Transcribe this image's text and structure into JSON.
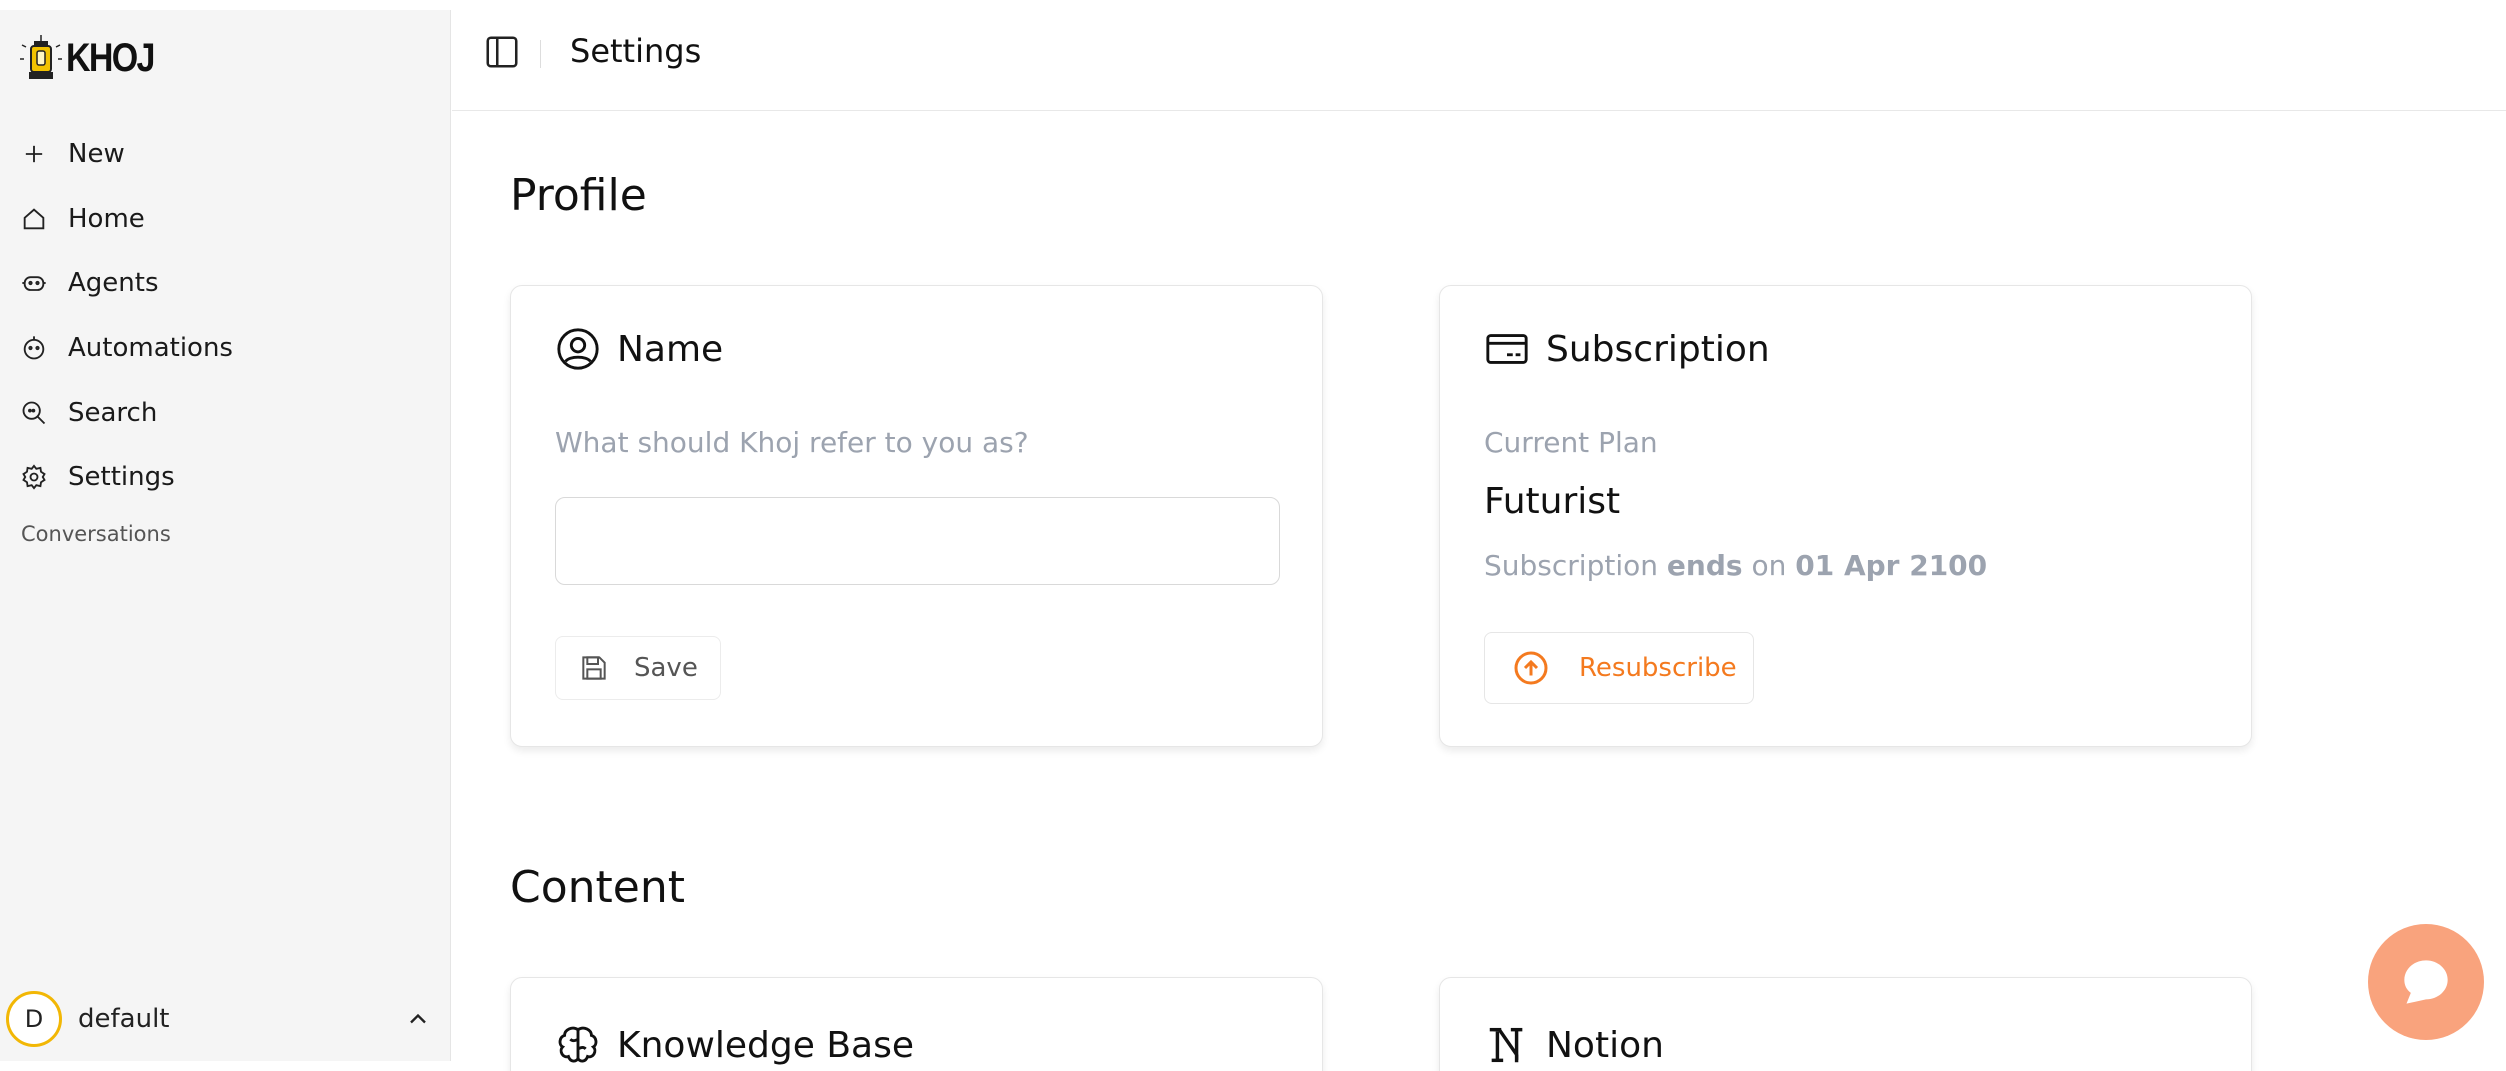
{
  "app": {
    "logo_text": "KHOJ"
  },
  "sidebar": {
    "items": [
      {
        "label": "New",
        "icon": "plus-icon"
      },
      {
        "label": "Home",
        "icon": "home-icon"
      },
      {
        "label": "Agents",
        "icon": "robot-icon"
      },
      {
        "label": "Automations",
        "icon": "automation-icon"
      },
      {
        "label": "Search",
        "icon": "search-icon"
      },
      {
        "label": "Settings",
        "icon": "gear-icon"
      }
    ],
    "section_label": "Conversations",
    "user": {
      "initial": "D",
      "name": "default"
    }
  },
  "header": {
    "title": "Settings"
  },
  "profile": {
    "section_title": "Profile",
    "name_card": {
      "title": "Name",
      "hint": "What should Khoj refer to you as?",
      "input_value": "",
      "save_label": "Save"
    },
    "subscription_card": {
      "title": "Subscription",
      "plan_label": "Current Plan",
      "plan_name": "Futurist",
      "line_prefix": "Subscription",
      "line_ends": "ends",
      "line_on": "on",
      "line_date": "01 Apr 2100",
      "resubscribe_label": "Resubscribe"
    }
  },
  "content": {
    "section_title": "Content",
    "knowledge_base_title": "Knowledge Base",
    "notion_title": "Notion"
  },
  "colors": {
    "accent": "#f47a1f",
    "fab": "#f9a37d",
    "avatar_ring": "#f2b705"
  }
}
